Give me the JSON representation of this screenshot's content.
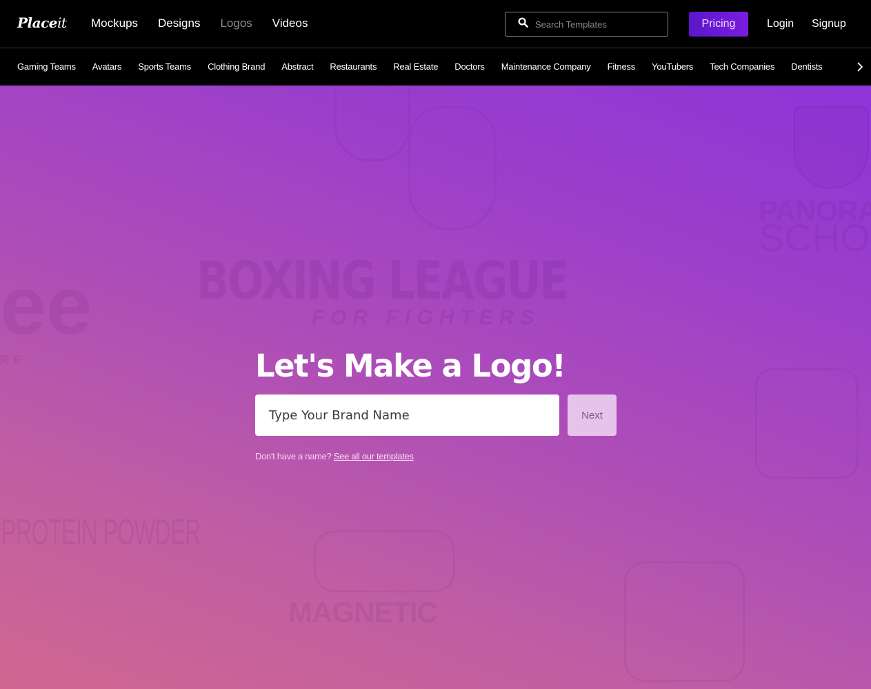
{
  "header": {
    "logo": {
      "main": "Place",
      "suffix": "it"
    },
    "nav": [
      {
        "label": "Mockups",
        "active": false
      },
      {
        "label": "Designs",
        "active": false
      },
      {
        "label": "Logos",
        "active": true
      },
      {
        "label": "Videos",
        "active": false
      }
    ],
    "search": {
      "placeholder": "Search Templates",
      "value": "",
      "icon": "search-icon"
    },
    "pricing_label": "Pricing",
    "login_label": "Login",
    "signup_label": "Signup"
  },
  "categories": {
    "items": [
      "Gaming Teams",
      "Avatars",
      "Sports Teams",
      "Clothing Brand",
      "Abstract",
      "Restaurants",
      "Real Estate",
      "Doctors",
      "Maintenance Company",
      "Fitness",
      "YouTubers",
      "Tech Companies",
      "Dentists"
    ],
    "next_icon": "chevron-right-icon"
  },
  "hero": {
    "title": "Let's Make a Logo!",
    "input": {
      "placeholder": "Type Your Brand Name",
      "value": ""
    },
    "next_label": "Next",
    "hint_text": "Don't have a name?",
    "hint_link": "See all our templates",
    "background_logos": {
      "boxing": "BOXING LEAGUE",
      "fighters": "FOR FIGHTERS",
      "panorama": "PANORA",
      "school": "SCHOO",
      "protein": "PROTEIN POWDER",
      "magnetic": "MAGNETIC",
      "partial_e": "ee",
      "partial_re": "RE"
    }
  },
  "colors": {
    "header_bg": "#000000",
    "pricing_gradient": [
      "#5a17c9",
      "#7b1ce0"
    ],
    "hero_gradient": [
      "#d06690",
      "#8f34d8"
    ],
    "next_button_bg": "#e6c3ea"
  }
}
